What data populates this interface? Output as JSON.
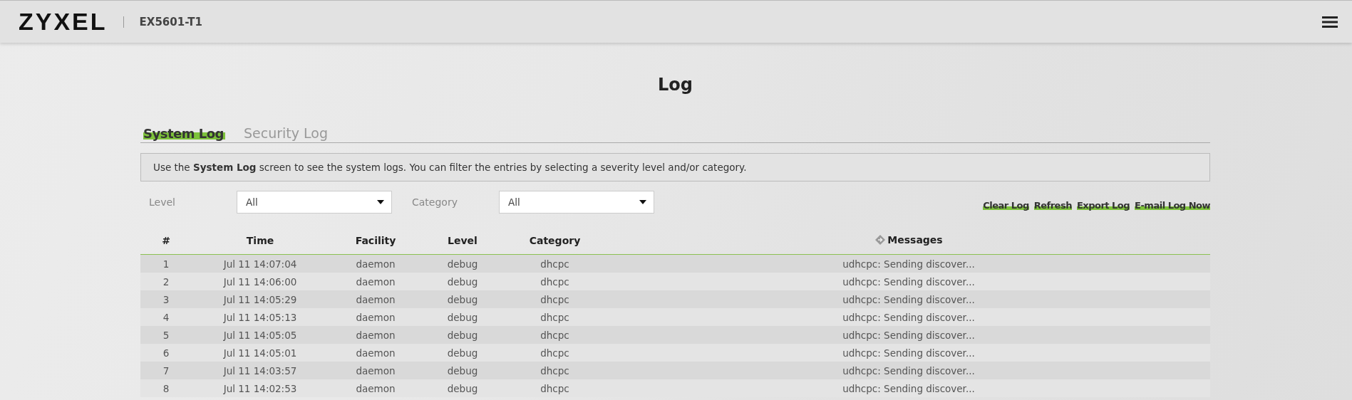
{
  "header": {
    "brand": "ZYXEL",
    "model": "EX5601-T1"
  },
  "page_title": "Log",
  "tabs": [
    {
      "label": "System Log",
      "selected": true
    },
    {
      "label": "Security Log",
      "selected": false
    }
  ],
  "info": "Use the **System Log** screen to see the system logs. You can filter the entries by selecting a severity level and/or category.",
  "filters": [
    {
      "label": "Level",
      "value": "All"
    },
    {
      "label": "Category",
      "value": "All"
    }
  ],
  "actions": [
    "Clear Log",
    "Refresh",
    "Export Log",
    "E-mail Log Now"
  ],
  "table": {
    "columns": [
      "#",
      "Time",
      "Facility",
      "Level",
      "Category",
      "Messages"
    ],
    "rows": [
      [
        "1",
        "Jul 11 14:07:04",
        "daemon",
        "debug",
        "dhcpc",
        "udhcpc: Sending discover..."
      ],
      [
        "2",
        "Jul 11 14:06:00",
        "daemon",
        "debug",
        "dhcpc",
        "udhcpc: Sending discover..."
      ],
      [
        "3",
        "Jul 11 14:05:29",
        "daemon",
        "debug",
        "dhcpc",
        "udhcpc: Sending discover..."
      ],
      [
        "4",
        "Jul 11 14:05:13",
        "daemon",
        "debug",
        "dhcpc",
        "udhcpc: Sending discover..."
      ],
      [
        "5",
        "Jul 11 14:05:05",
        "daemon",
        "debug",
        "dhcpc",
        "udhcpc: Sending discover..."
      ],
      [
        "6",
        "Jul 11 14:05:01",
        "daemon",
        "debug",
        "dhcpc",
        "udhcpc: Sending discover..."
      ],
      [
        "7",
        "Jul 11 14:03:57",
        "daemon",
        "debug",
        "dhcpc",
        "udhcpc: Sending discover..."
      ],
      [
        "8",
        "Jul 11 14:02:53",
        "daemon",
        "debug",
        "dhcpc",
        "udhcpc: Sending discover..."
      ]
    ]
  }
}
